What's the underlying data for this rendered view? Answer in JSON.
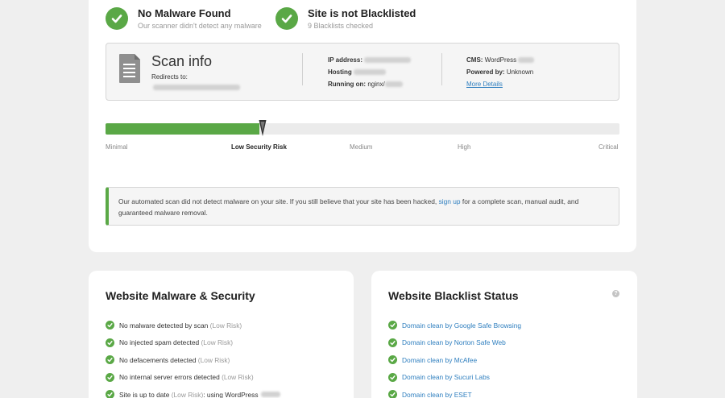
{
  "status": {
    "malware": {
      "title": "No Malware Found",
      "subtitle": "Our scanner didn't detect any malware"
    },
    "blacklist": {
      "title": "Site is not Blacklisted",
      "subtitle": "9 Blacklists checked"
    }
  },
  "scan_info": {
    "title": "Scan info",
    "redirects_label": "Redirects to:",
    "ip_label": "IP address:",
    "hosting_label": "Hosting",
    "running_label": "Running on:",
    "running_value": "nginx/",
    "cms_label": "CMS:",
    "cms_value": "WordPress",
    "powered_label": "Powered by:",
    "powered_value": "Unknown",
    "more_details": "More Details"
  },
  "risk": {
    "levels": [
      "Minimal",
      "Low Security Risk",
      "Medium",
      "High",
      "Critical"
    ],
    "active_index": 1,
    "value_fraction": 0.3
  },
  "notice": {
    "text_before": "Our automated scan did not detect malware on your site. If you still believe that your site has been hacked,",
    "link": "sign up",
    "text_after": "for a complete scan, manual audit, and guaranteed malware removal."
  },
  "malware_security": {
    "title": "Website Malware & Security",
    "items": [
      {
        "text": "No malware detected by scan",
        "risk": "(Low Risk)"
      },
      {
        "text": "No injected spam detected",
        "risk": "(Low Risk)"
      },
      {
        "text": "No defacements detected",
        "risk": "(Low Risk)"
      },
      {
        "text": "No internal server errors detected",
        "risk": "(Low Risk)"
      },
      {
        "text": "Site is up to date",
        "risk": "(Low Risk)",
        "suffix": ": using WordPress"
      }
    ]
  },
  "blacklist_status": {
    "title": "Website Blacklist Status",
    "help": "?",
    "items": [
      "Domain clean by Google Safe Browsing",
      "Domain clean by Norton Safe Web",
      "Domain clean by McAfee",
      "Domain clean by Sucuri Labs",
      "Domain clean by ESET"
    ]
  },
  "colors": {
    "accent_green": "#5aa846",
    "link_blue": "#2f7fbf"
  }
}
